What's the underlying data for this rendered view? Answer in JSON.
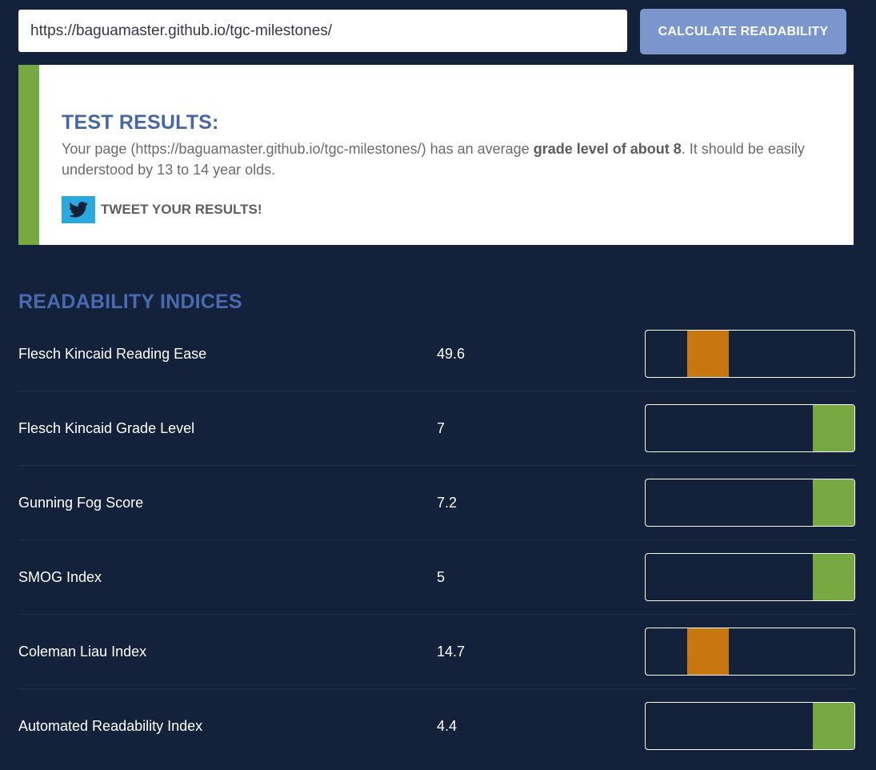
{
  "url_input": {
    "value": "https://baguamaster.github.io/tgc-milestones/"
  },
  "calculate_button": {
    "label": "CALCULATE READABILITY"
  },
  "results": {
    "title": "TEST RESULTS:",
    "text_before": "Your page (https://baguamaster.github.io/tgc-milestones/) has an average ",
    "text_bold": "grade level of about 8",
    "text_after": ". It should be easily understood by 13 to 14 year olds.",
    "tweet_label": "TWEET YOUR RESULTS!",
    "icon": "twitter-icon",
    "accent_color": "#77a943"
  },
  "indices": {
    "title": "READABILITY INDICES",
    "rows": [
      {
        "name": "Flesch Kincaid Reading Ease",
        "value": "49.6",
        "rating_position": 0.3,
        "color": "#c8760f"
      },
      {
        "name": "Flesch Kincaid Grade Level",
        "value": "7",
        "rating_position": 0.9,
        "color": "#77a943"
      },
      {
        "name": "Gunning Fog Score",
        "value": "7.2",
        "rating_position": 0.9,
        "color": "#77a943"
      },
      {
        "name": "SMOG Index",
        "value": "5",
        "rating_position": 0.9,
        "color": "#77a943"
      },
      {
        "name": "Coleman Liau Index",
        "value": "14.7",
        "rating_position": 0.3,
        "color": "#c8760f"
      },
      {
        "name": "Automated Readability Index",
        "value": "4.4",
        "rating_position": 0.9,
        "color": "#77a943"
      }
    ]
  }
}
